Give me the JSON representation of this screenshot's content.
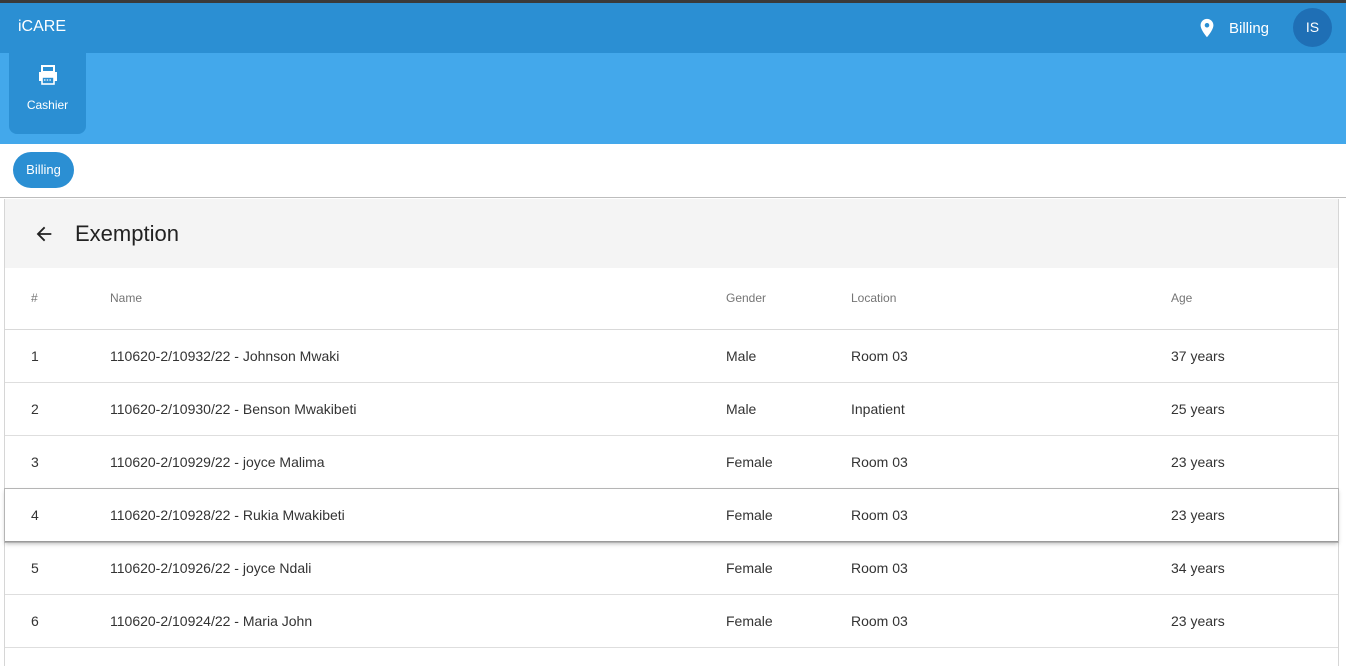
{
  "header": {
    "app_title": "iCARE",
    "location_label": "Billing",
    "user_initials": "IS"
  },
  "modules": [
    {
      "label": "Cashier",
      "icon": "printer-icon"
    }
  ],
  "subnav": {
    "active_pill": "Billing"
  },
  "page": {
    "title": "Exemption",
    "back_icon": "arrow-left-icon"
  },
  "table": {
    "columns": [
      "#",
      "Name",
      "Gender",
      "Location",
      "Age"
    ],
    "rows": [
      {
        "num": "1",
        "name": "110620-2/10932/22 - Johnson Mwaki",
        "gender": "Male",
        "location": "Room 03",
        "age": "37 years"
      },
      {
        "num": "2",
        "name": "110620-2/10930/22 - Benson Mwakibeti",
        "gender": "Male",
        "location": "Inpatient",
        "age": "25 years"
      },
      {
        "num": "3",
        "name": "110620-2/10929/22 - joyce Malima",
        "gender": "Female",
        "location": "Room 03",
        "age": "23 years"
      },
      {
        "num": "4",
        "name": "110620-2/10928/22 - Rukia Mwakibeti",
        "gender": "Female",
        "location": "Room 03",
        "age": "23 years"
      },
      {
        "num": "5",
        "name": "110620-2/10926/22 - joyce Ndali",
        "gender": "Female",
        "location": "Room 03",
        "age": "34 years"
      },
      {
        "num": "6",
        "name": "110620-2/10924/22 - Maria John",
        "gender": "Female",
        "location": "Room 03",
        "age": "23 years"
      }
    ]
  },
  "colors": {
    "topbar": "#2b8fd3",
    "modulebar": "#43a8eb",
    "accent": "#2b8fd3",
    "avatar": "#1f6fb5"
  }
}
